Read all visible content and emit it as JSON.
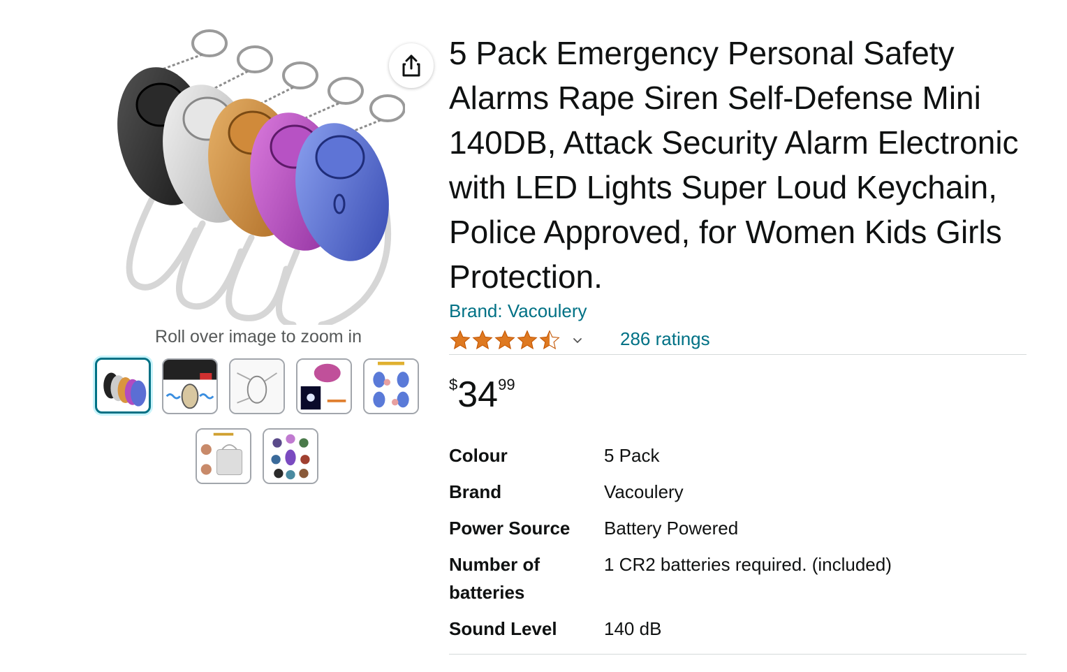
{
  "gallery": {
    "zoom_hint": "Roll over image to zoom in",
    "thumbnail_count": 7,
    "selected_thumbnail": 0
  },
  "product": {
    "title": "5 Pack Emergency Personal Safety Alarms Rape Siren Self-Defense Mini 140DB, Attack Security Alarm Electronic with LED Lights Super Loud Keychain, Police Approved, for Women Kids Girls Protection.",
    "brand_link": "Brand: Vacoulery",
    "rating": 4.5,
    "ratings_link": "286 ratings",
    "price": {
      "symbol": "$",
      "whole": "34",
      "fraction": "99"
    },
    "specs": [
      {
        "label": "Colour",
        "value": "5 Pack"
      },
      {
        "label": "Brand",
        "value": "Vacoulery"
      },
      {
        "label": "Power Source",
        "value": "Battery Powered"
      },
      {
        "label": "Number of batteries",
        "value": "1 CR2 batteries required. (included)"
      },
      {
        "label": "Sound Level",
        "value": "140 dB"
      }
    ]
  },
  "colors": {
    "link": "#007185",
    "star": "#de7921",
    "thumb_selected": "#007185"
  }
}
